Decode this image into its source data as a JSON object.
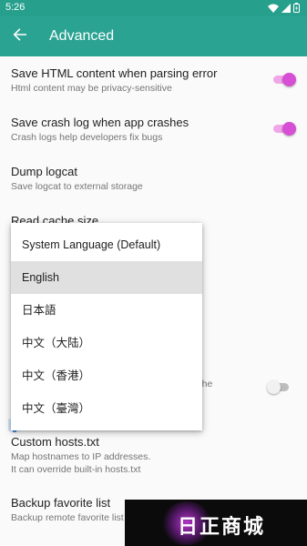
{
  "status_bar": {
    "time": "5:26"
  },
  "app_bar": {
    "title": "Advanced"
  },
  "settings": [
    {
      "title": "Save HTML content when parsing error",
      "summary": "Html content may be privacy-sensitive",
      "switch": "on"
    },
    {
      "title": "Save crash log when app crashes",
      "summary": "Crash logs help developers fix bugs",
      "switch": "on"
    },
    {
      "title": "Dump logcat",
      "summary": "Save logcat to external storage"
    },
    {
      "title": "Read cache size"
    },
    {
      "title": "Custom hosts.txt",
      "summary": "Map hostnames to IP addresses.",
      "summary2": "It can override built-in hosts.txt"
    },
    {
      "title": "Backup favorite list",
      "summary": "Backup remote favorite list"
    }
  ],
  "obscured_setting": {
    "summary_fragment": "d by the",
    "switch": "off"
  },
  "language_menu": {
    "options": [
      "System Language (Default)",
      "English",
      "日本語",
      "中文（大陆）",
      "中文（香港）",
      "中文（臺灣）"
    ],
    "selected": "English"
  },
  "watermark": {
    "text": "日正商城"
  },
  "colors": {
    "status_bar": "#26a08d",
    "app_bar": "#2aa393",
    "switch_on": "#d64fd4",
    "switch_track_on": "#f0a6e8"
  }
}
